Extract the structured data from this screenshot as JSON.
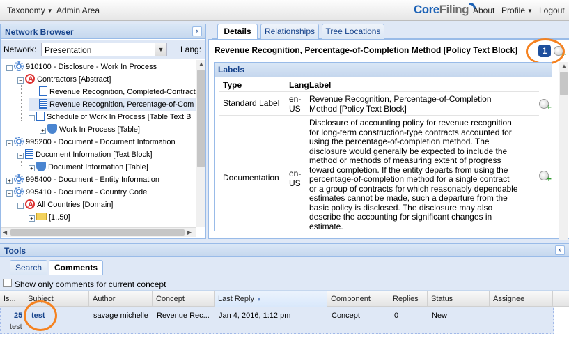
{
  "topbar": {
    "menu_taxonomy": "Taxonomy",
    "menu_admin": "Admin Area",
    "logo_core": "Core",
    "logo_filing": "Filing",
    "menu_about": "About",
    "menu_profile": "Profile",
    "menu_logout": "Logout"
  },
  "network_browser": {
    "title": "Network Browser",
    "network_label": "Network:",
    "network_value": "Presentation",
    "lang_label": "Lang:",
    "tree": [
      "910100 - Disclosure - Work In Process",
      "Contractors [Abstract]",
      "Revenue Recognition, Completed-Contract",
      "Revenue Recognition, Percentage-of-Com",
      "Schedule of Work In Process [Table Text B",
      "Work In Process [Table]",
      "995200 - Document - Document Information",
      "Document Information [Text Block]",
      "Document Information [Table]",
      "995400 - Document - Entity Information",
      "995410 - Document - Country Code",
      "All Countries [Domain]",
      "[1..50]"
    ]
  },
  "details": {
    "tabs": [
      "Details",
      "Relationships",
      "Tree Locations"
    ],
    "concept_title": "Revenue Recognition, Percentage-of-Completion Method [Policy Text Block]",
    "badge": "1",
    "labels_header": "Labels",
    "col_type": "Type",
    "col_lang": "Lang",
    "col_label": "Label",
    "rows": [
      {
        "type": "Standard Label",
        "lang": "en-US",
        "label": "Revenue Recognition, Percentage-of-Completion Method [Policy Text Block]"
      },
      {
        "type": "Documentation",
        "lang": "en-US",
        "label": "Disclosure of accounting policy for revenue recognition for long-term construction-type contracts accounted for using the percentage-of-completion method. The disclosure would generally be expected to include the method or methods of measuring extent of progress toward completion. If the entity departs from using the percentage-of-completion method for a single contract or a group of contracts for which reasonably dependable estimates cannot be made, such a departure from the basic policy is disclosed. The disclosure may also describe the accounting for significant changes in estimate."
      }
    ]
  },
  "tools": {
    "title": "Tools",
    "tabs": [
      "Search",
      "Comments"
    ],
    "checkbox_label": "Show only comments for current concept",
    "columns": [
      "Is...",
      "Subject",
      "Author",
      "Concept",
      "Last Reply",
      "Component",
      "Replies",
      "Status",
      "Assignee"
    ],
    "row": {
      "issue": "25",
      "subject": "test",
      "body": "test",
      "author": "savage michelle",
      "concept": "Revenue Rec...",
      "last_reply": "Jan 4, 2016, 1:12 pm",
      "component": "Concept",
      "replies": "0",
      "status": "New",
      "assignee": ""
    }
  },
  "colors": {
    "accent_orange": "#f58220",
    "header_blue": "#15428b",
    "badge_blue": "#1e4f9c"
  }
}
